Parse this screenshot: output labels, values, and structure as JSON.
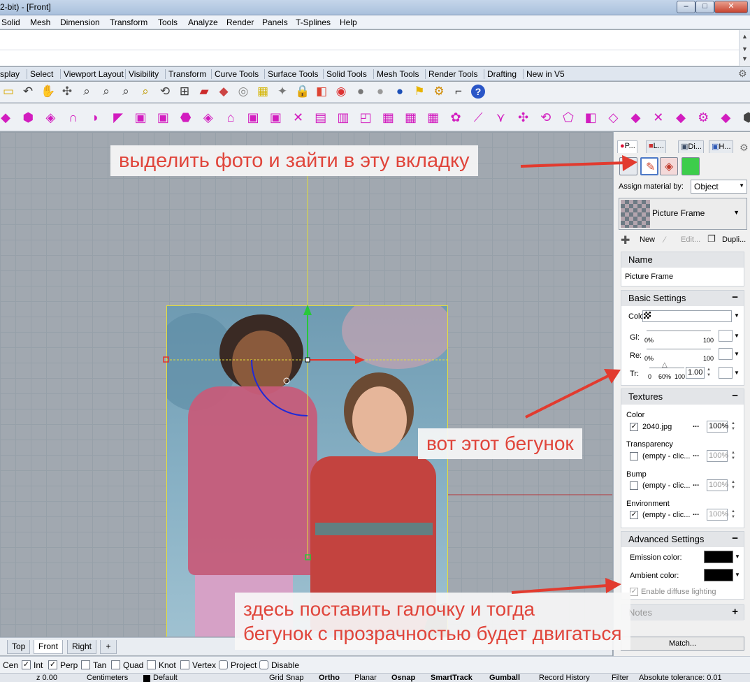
{
  "window": {
    "title": "2-bit) - [Front]",
    "minimize": "–",
    "maximize": "□",
    "close": "✕"
  },
  "menu": [
    "Solid",
    "Mesh",
    "Dimension",
    "Transform",
    "Tools",
    "Analyze",
    "Render",
    "Panels",
    "T-Splines",
    "Help"
  ],
  "toolbar_tabs": [
    "splay",
    "Select",
    "Viewport Layout",
    "Visibility",
    "Transform",
    "Curve Tools",
    "Surface Tools",
    "Solid Tools",
    "Mesh Tools",
    "Render Tools",
    "Drafting",
    "New in V5"
  ],
  "toolbar_icons_row1": [
    "open-icon",
    "undo-icon",
    "pan-icon",
    "rotate-icon",
    "zoom-icon",
    "zoom-window-icon",
    "zoom-extents-icon",
    "zoom-selected-icon",
    "rotate-view-icon",
    "four-viewports-icon",
    "car-icon",
    "cplane-icon",
    "circle-icon",
    "grid-snap-icon",
    "light-icon",
    "lock-icon",
    "layer-icon",
    "color-wheel-icon",
    "sphere-gray-icon",
    "sphere-render-icon",
    "sphere-blue-icon",
    "flag-icon",
    "gear-icon",
    "dimension-icon",
    "help-icon"
  ],
  "toolbar_icons_row2_count": 34,
  "viewport": {
    "tabs": [
      "Top",
      "Front",
      "Right"
    ],
    "active_tab": "Front",
    "add_tab": "+"
  },
  "osnap": [
    {
      "label": "Cen",
      "checked": false
    },
    {
      "label": "Int",
      "checked": true
    },
    {
      "label": "Perp",
      "checked": true
    },
    {
      "label": "Tan",
      "checked": false
    },
    {
      "label": "Quad",
      "checked": false
    },
    {
      "label": "Knot",
      "checked": false
    },
    {
      "label": "Vertex",
      "checked": false
    },
    {
      "label": "Project",
      "checked": false
    },
    {
      "label": "Disable",
      "checked": false
    }
  ],
  "status": {
    "coord": "z 0.00",
    "units": "Centimeters",
    "layer": "Default",
    "grid_snap": "Grid Snap",
    "ortho": "Ortho",
    "planar": "Planar",
    "osnap": "Osnap",
    "smarttrack": "SmartTrack",
    "gumball": "Gumball",
    "record_history": "Record History",
    "filter": "Filter",
    "tolerance": "Absolute tolerance: 0.01"
  },
  "panel": {
    "tabs": [
      "P...",
      "L...",
      "Di...",
      "H..."
    ],
    "assign_label": "Assign material by:",
    "assign_value": "Object",
    "material_name": "Picture Frame",
    "actions": {
      "new": "New",
      "edit": "Edit...",
      "duplicate": "Dupli..."
    },
    "name_section": {
      "header": "Name",
      "value": "Picture Frame"
    },
    "basic": {
      "header": "Basic Settings",
      "color_label": "Colo",
      "gloss_label": "Gl:",
      "refl_label": "Re:",
      "transp_label": "Tr:",
      "slider_min": "0%",
      "slider_max": "100",
      "transp_zero": "0",
      "transp_mid": "60%",
      "transp_max": "100",
      "transp_value": "1.00"
    },
    "textures": {
      "header": "Textures",
      "items": [
        {
          "label": "Color",
          "file": "2040.jpg",
          "checked": true,
          "percent": "100%",
          "enabled": true
        },
        {
          "label": "Transparency",
          "file": "(empty - clic...",
          "checked": false,
          "percent": "100%",
          "enabled": false
        },
        {
          "label": "Bump",
          "file": "(empty - clic...",
          "checked": false,
          "percent": "100%",
          "enabled": false
        },
        {
          "label": "Environment",
          "file": "(empty - clic...",
          "checked": true,
          "percent": "100%",
          "enabled": false
        }
      ],
      "dots": "..."
    },
    "advanced": {
      "header": "Advanced Settings",
      "emission_label": "Emission color:",
      "ambient_label": "Ambient color:",
      "diffuse_label": "Enable diffuse lighting"
    },
    "notes": {
      "header": "Notes"
    },
    "match_button": "Match..."
  },
  "annotations": {
    "top": "выделить фото и зайти в эту вкладку",
    "middle": "вот этот бегунок",
    "bottom_line1": "здесь поставить галочку и тогда",
    "bottom_line2": "бегунок с прозрачностью будет двигаться"
  },
  "colors": {
    "annotation_text": "#e0453b",
    "arrow": "#e23b2f",
    "frame": "#e5df3b",
    "gumball_y": "#28c83a",
    "gumball_x": "#e6332a"
  }
}
